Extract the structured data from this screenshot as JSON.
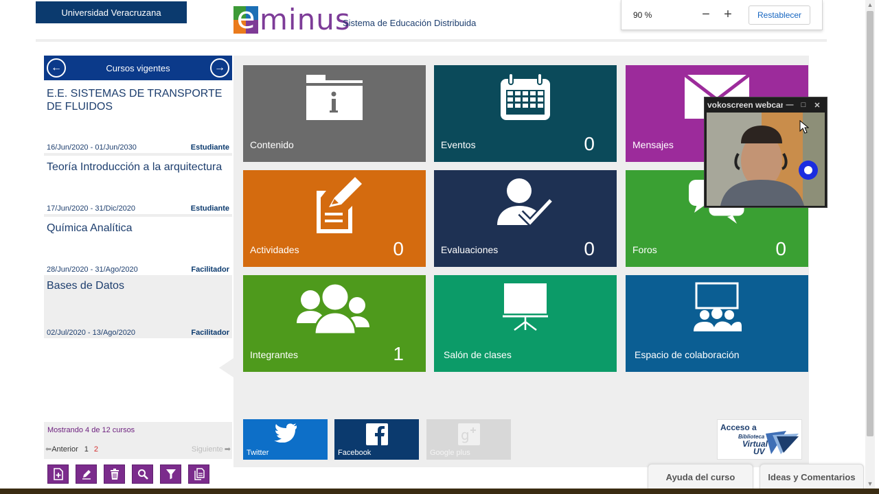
{
  "header": {
    "university": "Universidad Veracruzana",
    "logo_word": "minus",
    "logo_letter": "e",
    "subtitle": "Sistema de Educación Distribuida"
  },
  "zoom": {
    "value": "90 %",
    "minus": "−",
    "plus": "+",
    "reset": "Restablecer"
  },
  "sidebar": {
    "title": "Cursos vigentes",
    "prev_icon": "arrow-left-icon",
    "next_icon": "arrow-right-icon",
    "courses": [
      {
        "name": "E.E. SISTEMAS DE TRANSPORTE DE FLUIDOS",
        "dates": "16/Jun/2020 - 01/Jun/2030",
        "role": "Estudiante"
      },
      {
        "name": "Teoría Introducción a la arquitectura",
        "dates": "17/Jun/2020 - 31/Dic/2020",
        "role": "Estudiante"
      },
      {
        "name": "Química Analítica",
        "dates": "28/Jun/2020 - 31/Ago/2020",
        "role": "Facilitador"
      },
      {
        "name": "Bases de Datos",
        "dates": "02/Jul/2020 - 13/Ago/2020",
        "role": "Facilitador"
      }
    ],
    "showing": "Mostrando 4 de 12 cursos",
    "pager": {
      "prev": "Anterior",
      "pages": [
        "1",
        "2"
      ],
      "next": "Siguiente"
    },
    "tools": [
      "add-course-icon",
      "edit-icon",
      "delete-icon",
      "search-icon",
      "filter-icon",
      "copy-icon"
    ]
  },
  "tiles": [
    {
      "label": "Contenido",
      "count": "",
      "color": "#6b6b6b",
      "icon": "folder-info-icon"
    },
    {
      "label": "Eventos",
      "count": "0",
      "color": "#0b4a5a",
      "icon": "calendar-icon"
    },
    {
      "label": "Mensajes",
      "count": "",
      "color": "#9c2b9b",
      "icon": "envelope-icon"
    },
    {
      "label": "Actividades",
      "count": "0",
      "color": "#d46b0f",
      "icon": "edit-document-icon"
    },
    {
      "label": "Evaluaciones",
      "count": "0",
      "color": "#1e3153",
      "icon": "user-check-icon"
    },
    {
      "label": "Foros",
      "count": "0",
      "color": "#3aa033",
      "icon": "chat-bubbles-icon"
    },
    {
      "label": "Integrantes",
      "count": "1",
      "color": "#4e9a1c",
      "icon": "group-icon"
    },
    {
      "label": "Salón de clases",
      "count": "",
      "color": "#0c9b68",
      "icon": "presentation-board-icon"
    },
    {
      "label": "Espacio de colaboración",
      "count": "",
      "color": "#0b5e93",
      "icon": "collaboration-icon"
    }
  ],
  "social": [
    {
      "label": "Twitter",
      "color": "#0d6fc8",
      "icon": "twitter-icon"
    },
    {
      "label": "Facebook",
      "color": "#0b3a6e",
      "icon": "facebook-icon"
    },
    {
      "label": "Google plus",
      "color": "#d8d8d8",
      "icon": "google-plus-icon"
    }
  ],
  "biblio": {
    "line1": "Acceso a",
    "line2": "Biblioteca",
    "line3": "Virtual",
    "line4": "UV"
  },
  "bottom_tabs": [
    "Ayuda del curso",
    "Ideas y Comentarios"
  ],
  "webcam": {
    "title": "vokoscreen webcam"
  }
}
